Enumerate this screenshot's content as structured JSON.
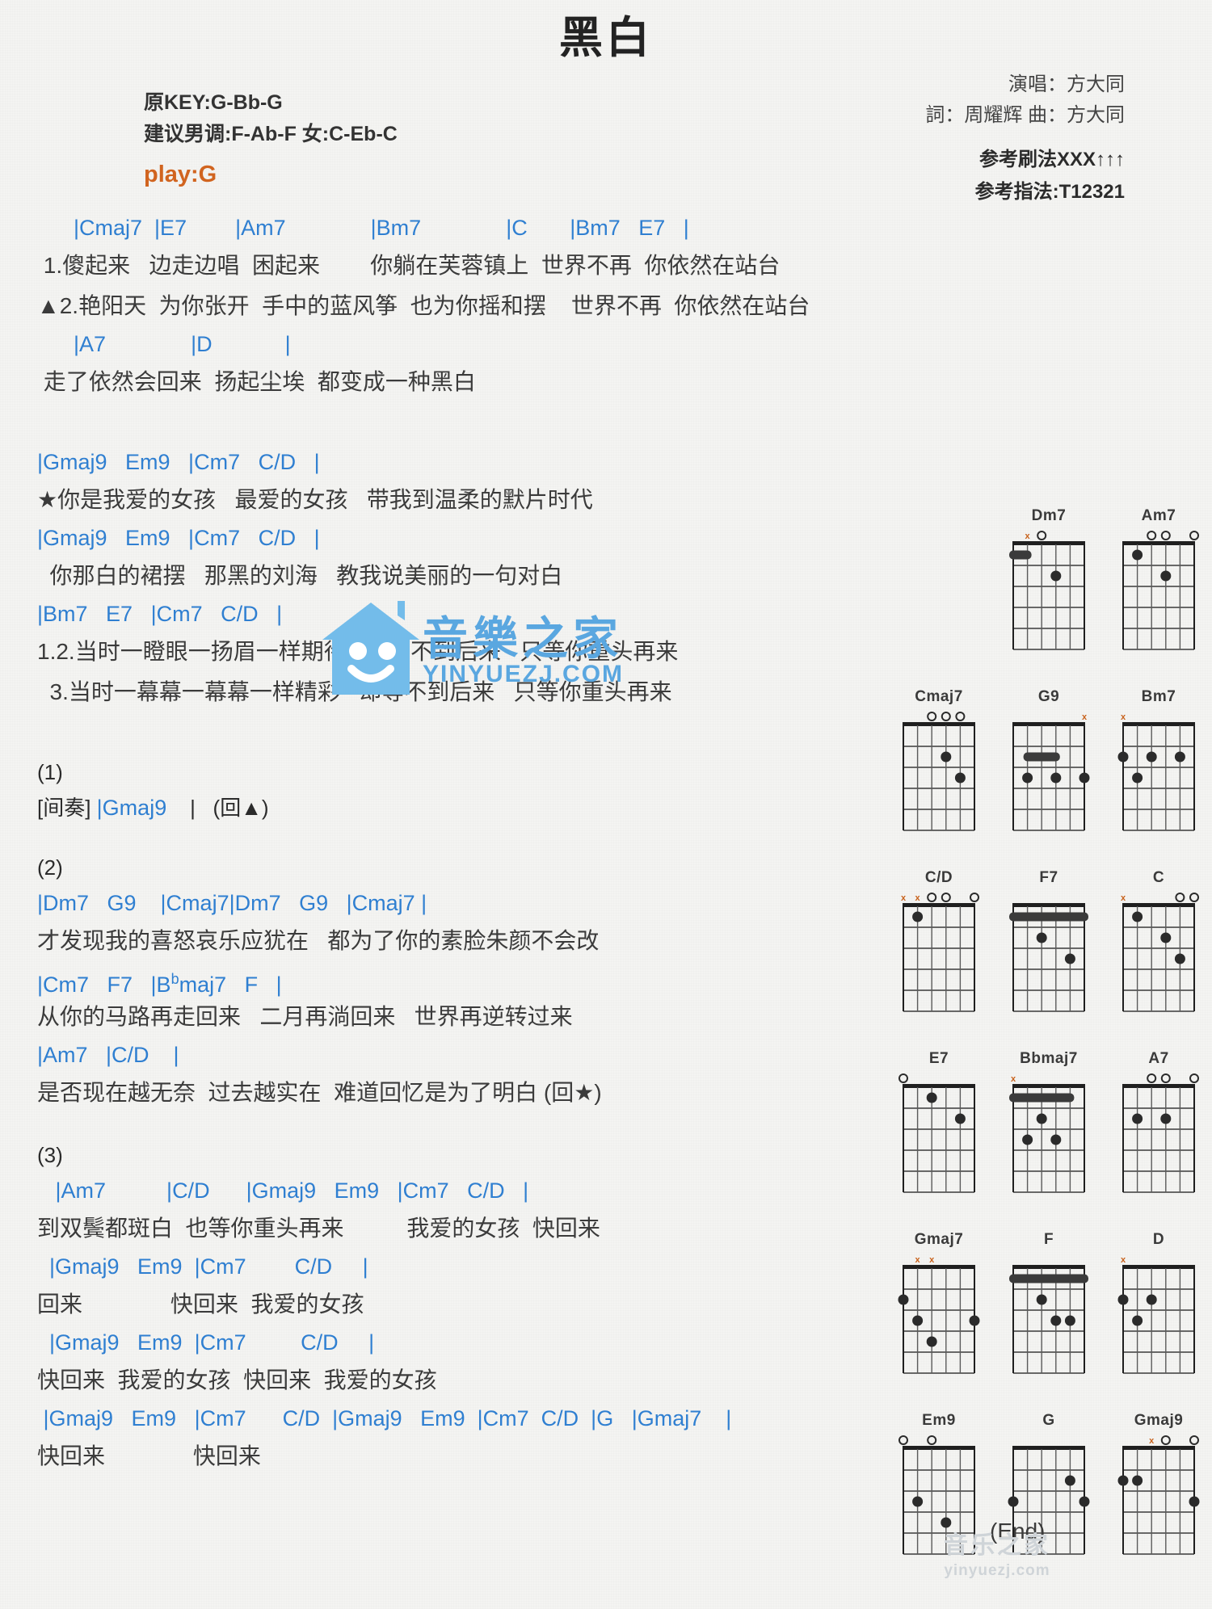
{
  "header": {
    "title": "黑白",
    "orig_key": "原KEY:G-Bb-G",
    "suggest_key": "建议男调:F-Ab-F 女:C-Eb-C",
    "play": "play:G",
    "singer": "演唱：方大同",
    "writer": "詞：周耀辉   曲：方大同",
    "strum": "参考刷法XXX↑↑↑",
    "finger": "参考指法:T12321",
    "accent_orange": "#d1641f",
    "accent_blue": "#2f7fd1"
  },
  "sections": [
    {
      "name": "verse-1",
      "lines": [
        {
          "type": "chords",
          "text": "      |Cmaj7  |E7        |Am7              |Bm7              |C       |Bm7   E7   |"
        },
        {
          "type": "lyrics",
          "text": " 1.傻起来   边走边唱  困起来        你躺在芙蓉镇上  世界不再  你依然在站台"
        },
        {
          "type": "lyrics",
          "text": "▲2.艳阳天  为你张开  手中的蓝风筝  也为你摇和摆    世界不再  你依然在站台"
        },
        {
          "type": "chords",
          "text": "      |A7              |D            |"
        },
        {
          "type": "lyrics",
          "text": " 走了依然会回来  扬起尘埃  都变成一种黑白"
        }
      ]
    },
    {
      "name": "chorus-1",
      "lines": [
        {
          "type": "chords",
          "text": "|Gmaj9   Em9   |Cm7   C/D   |"
        },
        {
          "type": "lyrics",
          "text": "★你是我爱的女孩   最爱的女孩   带我到温柔的默片时代"
        },
        {
          "type": "chords",
          "text": "|Gmaj9   Em9   |Cm7   C/D   |"
        },
        {
          "type": "lyrics",
          "text": "  你那白的裙摆   那黑的刘海   教我说美丽的一句对白"
        },
        {
          "type": "chords",
          "text": "|Bm7   E7   |Cm7   C/D   |"
        },
        {
          "type": "lyrics",
          "text": "1.2.当时一瞪眼一扬眉一样期待   却等不到后来   只等你重头再来"
        },
        {
          "type": "lyrics",
          "text": "  3.当时一幕幕一幕幕一样精彩   却等不到后来   只等你重头再来"
        }
      ]
    },
    {
      "name": "interlude-1",
      "lines": [
        {
          "type": "mark",
          "text": "(1)"
        },
        {
          "type": "mixed",
          "text": "[间奏] |Gmaj9    |   (回▲)"
        }
      ]
    },
    {
      "name": "verse-2",
      "lines": [
        {
          "type": "mark",
          "text": "(2)"
        },
        {
          "type": "chords",
          "text": "|Dm7   G9    |Cmaj7|Dm7   G9   |Cmaj7 |"
        },
        {
          "type": "lyrics",
          "text": "才发现我的喜怒哀乐应犹在   都为了你的素脸朱颜不会改"
        },
        {
          "type": "chords",
          "text": "|Cm7   F7   |B♭maj7   F   |"
        },
        {
          "type": "lyrics",
          "text": "从你的马路再走回来   二月再淌回来   世界再逆转过来"
        },
        {
          "type": "chords",
          "text": "|Am7   |C/D    |"
        },
        {
          "type": "lyrics",
          "text": "是否现在越无奈  过去越实在  难道回忆是为了明白 (回★)"
        }
      ]
    },
    {
      "name": "outro",
      "lines": [
        {
          "type": "mark",
          "text": "(3)"
        },
        {
          "type": "chords",
          "text": "   |Am7          |C/D      |Gmaj9   Em9   |Cm7   C/D   |"
        },
        {
          "type": "lyrics",
          "text": "到双鬓都斑白  也等你重头再来          我爱的女孩  快回来"
        },
        {
          "type": "chords",
          "text": "  |Gmaj9   Em9  |Cm7        C/D     |"
        },
        {
          "type": "lyrics",
          "text": "回来              快回来  我爱的女孩"
        },
        {
          "type": "chords",
          "text": "  |Gmaj9   Em9  |Cm7         C/D     |"
        },
        {
          "type": "lyrics",
          "text": "快回来  我爱的女孩  快回来  我爱的女孩"
        },
        {
          "type": "chords",
          "text": " |Gmaj9   Em9   |Cm7      C/D  |Gmaj9   Em9  |Cm7  C/D  |G   |Gmaj7    |"
        },
        {
          "type": "lyrics",
          "text": "快回来              快回来"
        }
      ]
    }
  ],
  "end_label": "(End)",
  "diagrams": [
    [
      null,
      {
        "name": "Dm7",
        "markers": [
          "",
          "x",
          "o",
          "",
          "",
          ""
        ],
        "dots": [
          {
            "s": 4,
            "f": 2
          }
        ],
        "bars": [
          {
            "f": 1,
            "from": 1,
            "to": 2
          }
        ]
      },
      {
        "name": "Am7",
        "markers": [
          "",
          "",
          "o",
          "o",
          "",
          "o"
        ],
        "dots": [
          {
            "s": 4,
            "f": 2
          },
          {
            "s": 2,
            "f": 1
          }
        ]
      }
    ],
    [
      {
        "name": "Cmaj7",
        "markers": [
          "",
          "",
          "o",
          "o",
          "o",
          ""
        ],
        "dots": [
          {
            "s": 4,
            "f": 2
          },
          {
            "s": 5,
            "f": 3
          }
        ]
      },
      {
        "name": "G9",
        "markers": [
          "",
          "",
          "",
          "",
          "",
          "x"
        ],
        "dots": [
          {
            "s": 6,
            "f": 3
          },
          {
            "s": 4,
            "f": 3
          },
          {
            "s": 2,
            "f": 3
          }
        ],
        "bars": [
          {
            "f": 2,
            "from": 2,
            "to": 4
          }
        ]
      },
      {
        "name": "Bm7",
        "markers": [
          "x",
          "",
          "",
          "",
          "",
          ""
        ],
        "dots": [
          {
            "s": 5,
            "f": 2
          },
          {
            "s": 3,
            "f": 2
          },
          {
            "s": 1,
            "f": 2
          },
          {
            "s": 2,
            "f": 3
          }
        ]
      }
    ],
    [
      {
        "name": "C/D",
        "markers": [
          "x",
          "x",
          "o",
          "o",
          "",
          "o"
        ],
        "dots": [
          {
            "s": 2,
            "f": 1
          }
        ]
      },
      {
        "name": "F7",
        "markers": [
          "",
          "",
          "",
          "",
          "",
          ""
        ],
        "dots": [
          {
            "s": 3,
            "f": 2
          },
          {
            "s": 5,
            "f": 3
          }
        ],
        "bars": [
          {
            "f": 1,
            "from": 1,
            "to": 6
          }
        ]
      },
      {
        "name": "C",
        "markers": [
          "x",
          "",
          "",
          "",
          "o",
          "o"
        ],
        "dots": [
          {
            "s": 2,
            "f": 1
          },
          {
            "s": 4,
            "f": 2
          },
          {
            "s": 5,
            "f": 3
          }
        ]
      }
    ],
    [
      {
        "name": "E7",
        "markers": [
          "o",
          "",
          "",
          "",
          "",
          ""
        ],
        "dots": [
          {
            "s": 3,
            "f": 1
          },
          {
            "s": 5,
            "f": 2
          }
        ]
      },
      {
        "name": "Bbmaj7",
        "markers": [
          "x",
          "",
          "",
          "",
          "",
          ""
        ],
        "dots": [
          {
            "s": 3,
            "f": 2
          },
          {
            "s": 4,
            "f": 3
          },
          {
            "s": 2,
            "f": 3
          }
        ],
        "bars": [
          {
            "f": 1,
            "from": 1,
            "to": 5
          }
        ]
      },
      {
        "name": "A7",
        "markers": [
          "",
          "",
          "o",
          "o",
          "",
          "o"
        ],
        "dots": [
          {
            "s": 4,
            "f": 2
          },
          {
            "s": 2,
            "f": 2
          }
        ]
      }
    ],
    [
      {
        "name": "Gmaj7",
        "markers": [
          "",
          "x",
          "x",
          "",
          "",
          ""
        ],
        "dots": [
          {
            "s": 6,
            "f": 3
          },
          {
            "s": 3,
            "f": 4
          },
          {
            "s": 2,
            "f": 3
          },
          {
            "s": 1,
            "f": 2
          }
        ]
      },
      {
        "name": "F",
        "markers": [
          "",
          "",
          "",
          "",
          "",
          ""
        ],
        "dots": [
          {
            "s": 5,
            "f": 3
          },
          {
            "s": 4,
            "f": 3
          },
          {
            "s": 3,
            "f": 2
          }
        ],
        "bars": [
          {
            "f": 1,
            "from": 1,
            "to": 6
          }
        ]
      },
      {
        "name": "D",
        "markers": [
          "x",
          "",
          "",
          "",
          "",
          ""
        ],
        "dots": [
          {
            "s": 3,
            "f": 2
          },
          {
            "s": 1,
            "f": 2
          },
          {
            "s": 2,
            "f": 3
          }
        ]
      }
    ],
    [
      {
        "name": "Em9",
        "markers": [
          "o",
          "",
          "o",
          "",
          "",
          ""
        ],
        "dots": [
          {
            "s": 2,
            "f": 3
          },
          {
            "s": 4,
            "f": 4
          }
        ]
      },
      {
        "name": "G",
        "markers": [
          "",
          "",
          "",
          "",
          "",
          ""
        ],
        "dots": [
          {
            "s": 6,
            "f": 3
          },
          {
            "s": 5,
            "f": 2
          },
          {
            "s": 1,
            "f": 3
          }
        ]
      },
      {
        "name": "Gmaj9",
        "markers": [
          "",
          "",
          "x",
          "o",
          "",
          "o"
        ],
        "dots": [
          {
            "s": 6,
            "f": 3
          },
          {
            "s": 2,
            "f": 2
          },
          {
            "s": 1,
            "f": 2
          }
        ]
      }
    ]
  ],
  "watermark": {
    "brand": "音樂之家",
    "url": "YINYUEZJ.COM",
    "bottom_brand": "音乐之家",
    "bottom_url": "yinyuezj.com"
  }
}
